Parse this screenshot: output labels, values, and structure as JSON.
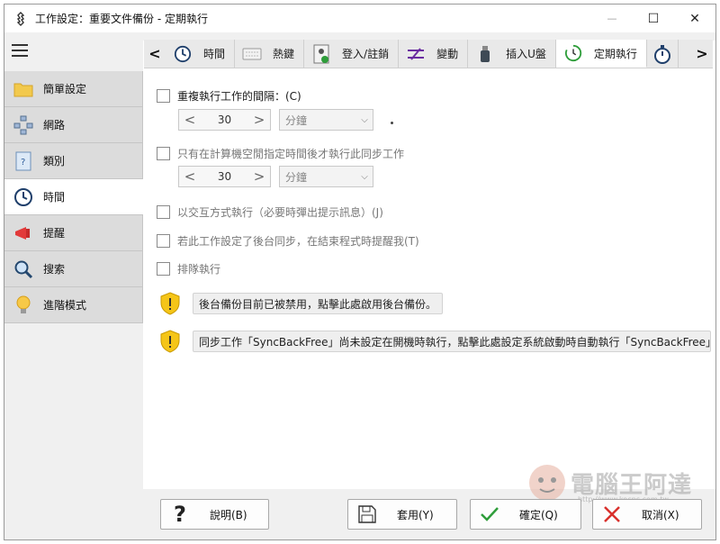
{
  "window": {
    "title": "工作設定：重要文件備份 - 定期執行",
    "minimize": "—",
    "maximize": "☐",
    "close": "✕"
  },
  "sidebar": {
    "items": [
      {
        "label": "簡單設定",
        "icon": "folder-icon"
      },
      {
        "label": "網路",
        "icon": "network-icon"
      },
      {
        "label": "類別",
        "icon": "help-file-icon"
      },
      {
        "label": "時間",
        "icon": "clock-icon"
      },
      {
        "label": "提醒",
        "icon": "megaphone-icon"
      },
      {
        "label": "搜索",
        "icon": "magnifier-icon"
      },
      {
        "label": "進階模式",
        "icon": "lightbulb-icon"
      }
    ],
    "active_index": 3
  },
  "tabs": {
    "prev": "<",
    "next": ">",
    "items": [
      {
        "label": "時間",
        "icon": "clock-icon"
      },
      {
        "label": "熱鍵",
        "icon": "keyboard-icon"
      },
      {
        "label": "登入/註銷",
        "icon": "user-badge-icon"
      },
      {
        "label": "變動",
        "icon": "change-icon"
      },
      {
        "label": "插入U盤",
        "icon": "usb-icon"
      },
      {
        "label": "定期執行",
        "icon": "refresh-clock-icon"
      }
    ],
    "active_index": 5
  },
  "options": {
    "repeat_interval": {
      "label": "重複執行工作的間隔：(C)",
      "checked": false,
      "value": "30",
      "unit": "分鐘",
      "trailing": "."
    },
    "idle_run": {
      "label": "只有在計算機空閒指定時間後才執行此同步工作",
      "checked": false,
      "value": "30",
      "unit": "分鐘"
    },
    "interactive": {
      "label": "以交互方式執行（必要時彈出提示訊息）(J)",
      "checked": false
    },
    "background_remind": {
      "label": "若此工作設定了後台同步，在結束程式時提醒我(T)",
      "checked": false
    },
    "queue": {
      "label": "排隊執行",
      "checked": false
    }
  },
  "notices": [
    {
      "text": "後台備份目前已被禁用，點擊此處啟用後台備份。"
    },
    {
      "text": "同步工作「SyncBackFree」尚未設定在開機時執行，點擊此處設定系統啟動時自動執行「SyncBackFree」"
    }
  ],
  "buttons": {
    "help": "說明(B)",
    "apply": "套用(Y)",
    "ok": "確定(Q)",
    "cancel": "取消(X)"
  },
  "watermark": {
    "text": "電腦王阿達",
    "url": "http://www.kocpc.com.tw"
  },
  "colors": {
    "sidebar_bg": "#dcdcdc",
    "tab_bg": "#e9e9e9",
    "warning": "#f5c518",
    "ok_green": "#2e9d3a",
    "cancel_red": "#d9302c"
  }
}
